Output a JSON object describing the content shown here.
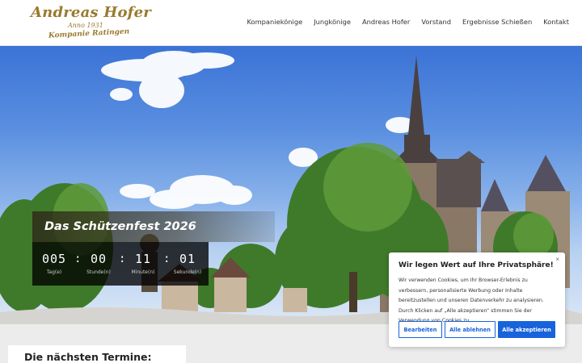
{
  "logo": {
    "line1": "Andreas Hofer",
    "line2": "Anno 1931",
    "line3": "Kompanie Ratingen"
  },
  "nav": {
    "items": [
      {
        "label": "Kompaniekönige"
      },
      {
        "label": "Jungkönige"
      },
      {
        "label": "Andreas Hofer"
      },
      {
        "label": "Vorstand"
      },
      {
        "label": "Ergebnisse Schießen"
      },
      {
        "label": "Kontakt"
      }
    ]
  },
  "countdown": {
    "title": "Das Schützenfest 2026",
    "units": [
      {
        "value": "005",
        "label": "Tag(e)"
      },
      {
        "value": "00",
        "label": "Stunde(n)"
      },
      {
        "value": "11",
        "label": "Minute(n)"
      },
      {
        "value": "01",
        "label": "Sekunde(n)"
      }
    ],
    "separator": ":"
  },
  "section": {
    "termine_title": "Die nächsten Termine:"
  },
  "cookie": {
    "close": "×",
    "title": "Wir legen Wert auf Ihre Privatsphäre!",
    "text": "Wir verwenden Cookies, um Ihr Browser-Erlebnis zu verbessern, personalisierte Werbung oder Inhalte bereitzustellen und unseren Datenverkehr zu analysieren. Durch Klicken auf „Alle akzeptieren“ stimmen Sie der Verwendung von Cookies zu.",
    "btn_customize": "Bearbeiten",
    "btn_reject": "Alle ablehnen",
    "btn_accept": "Alle akzeptieren"
  },
  "colors": {
    "logo_gold": "#9a7a2e",
    "cookie_blue": "#1863dc"
  }
}
